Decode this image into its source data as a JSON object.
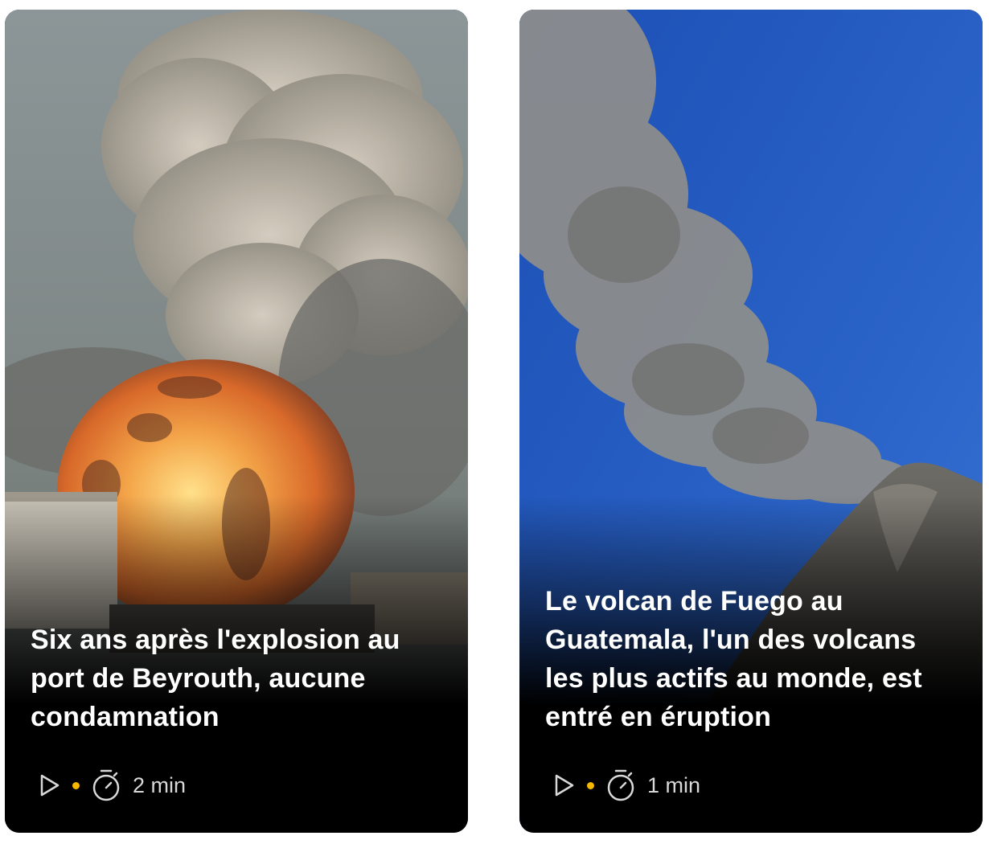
{
  "accent_color": "#f5b800",
  "cards": [
    {
      "title": "Six ans après l'explosion au port de Beyrouth, aucune condamnation",
      "media_icon": "play-icon",
      "duration_icon": "stopwatch-icon",
      "duration": "2 min"
    },
    {
      "title": "Le volcan de Fuego au Guatemala, l'un des volcans les plus actifs au monde, est entré en éruption",
      "media_icon": "play-icon",
      "duration_icon": "stopwatch-icon",
      "duration": "1 min"
    }
  ]
}
